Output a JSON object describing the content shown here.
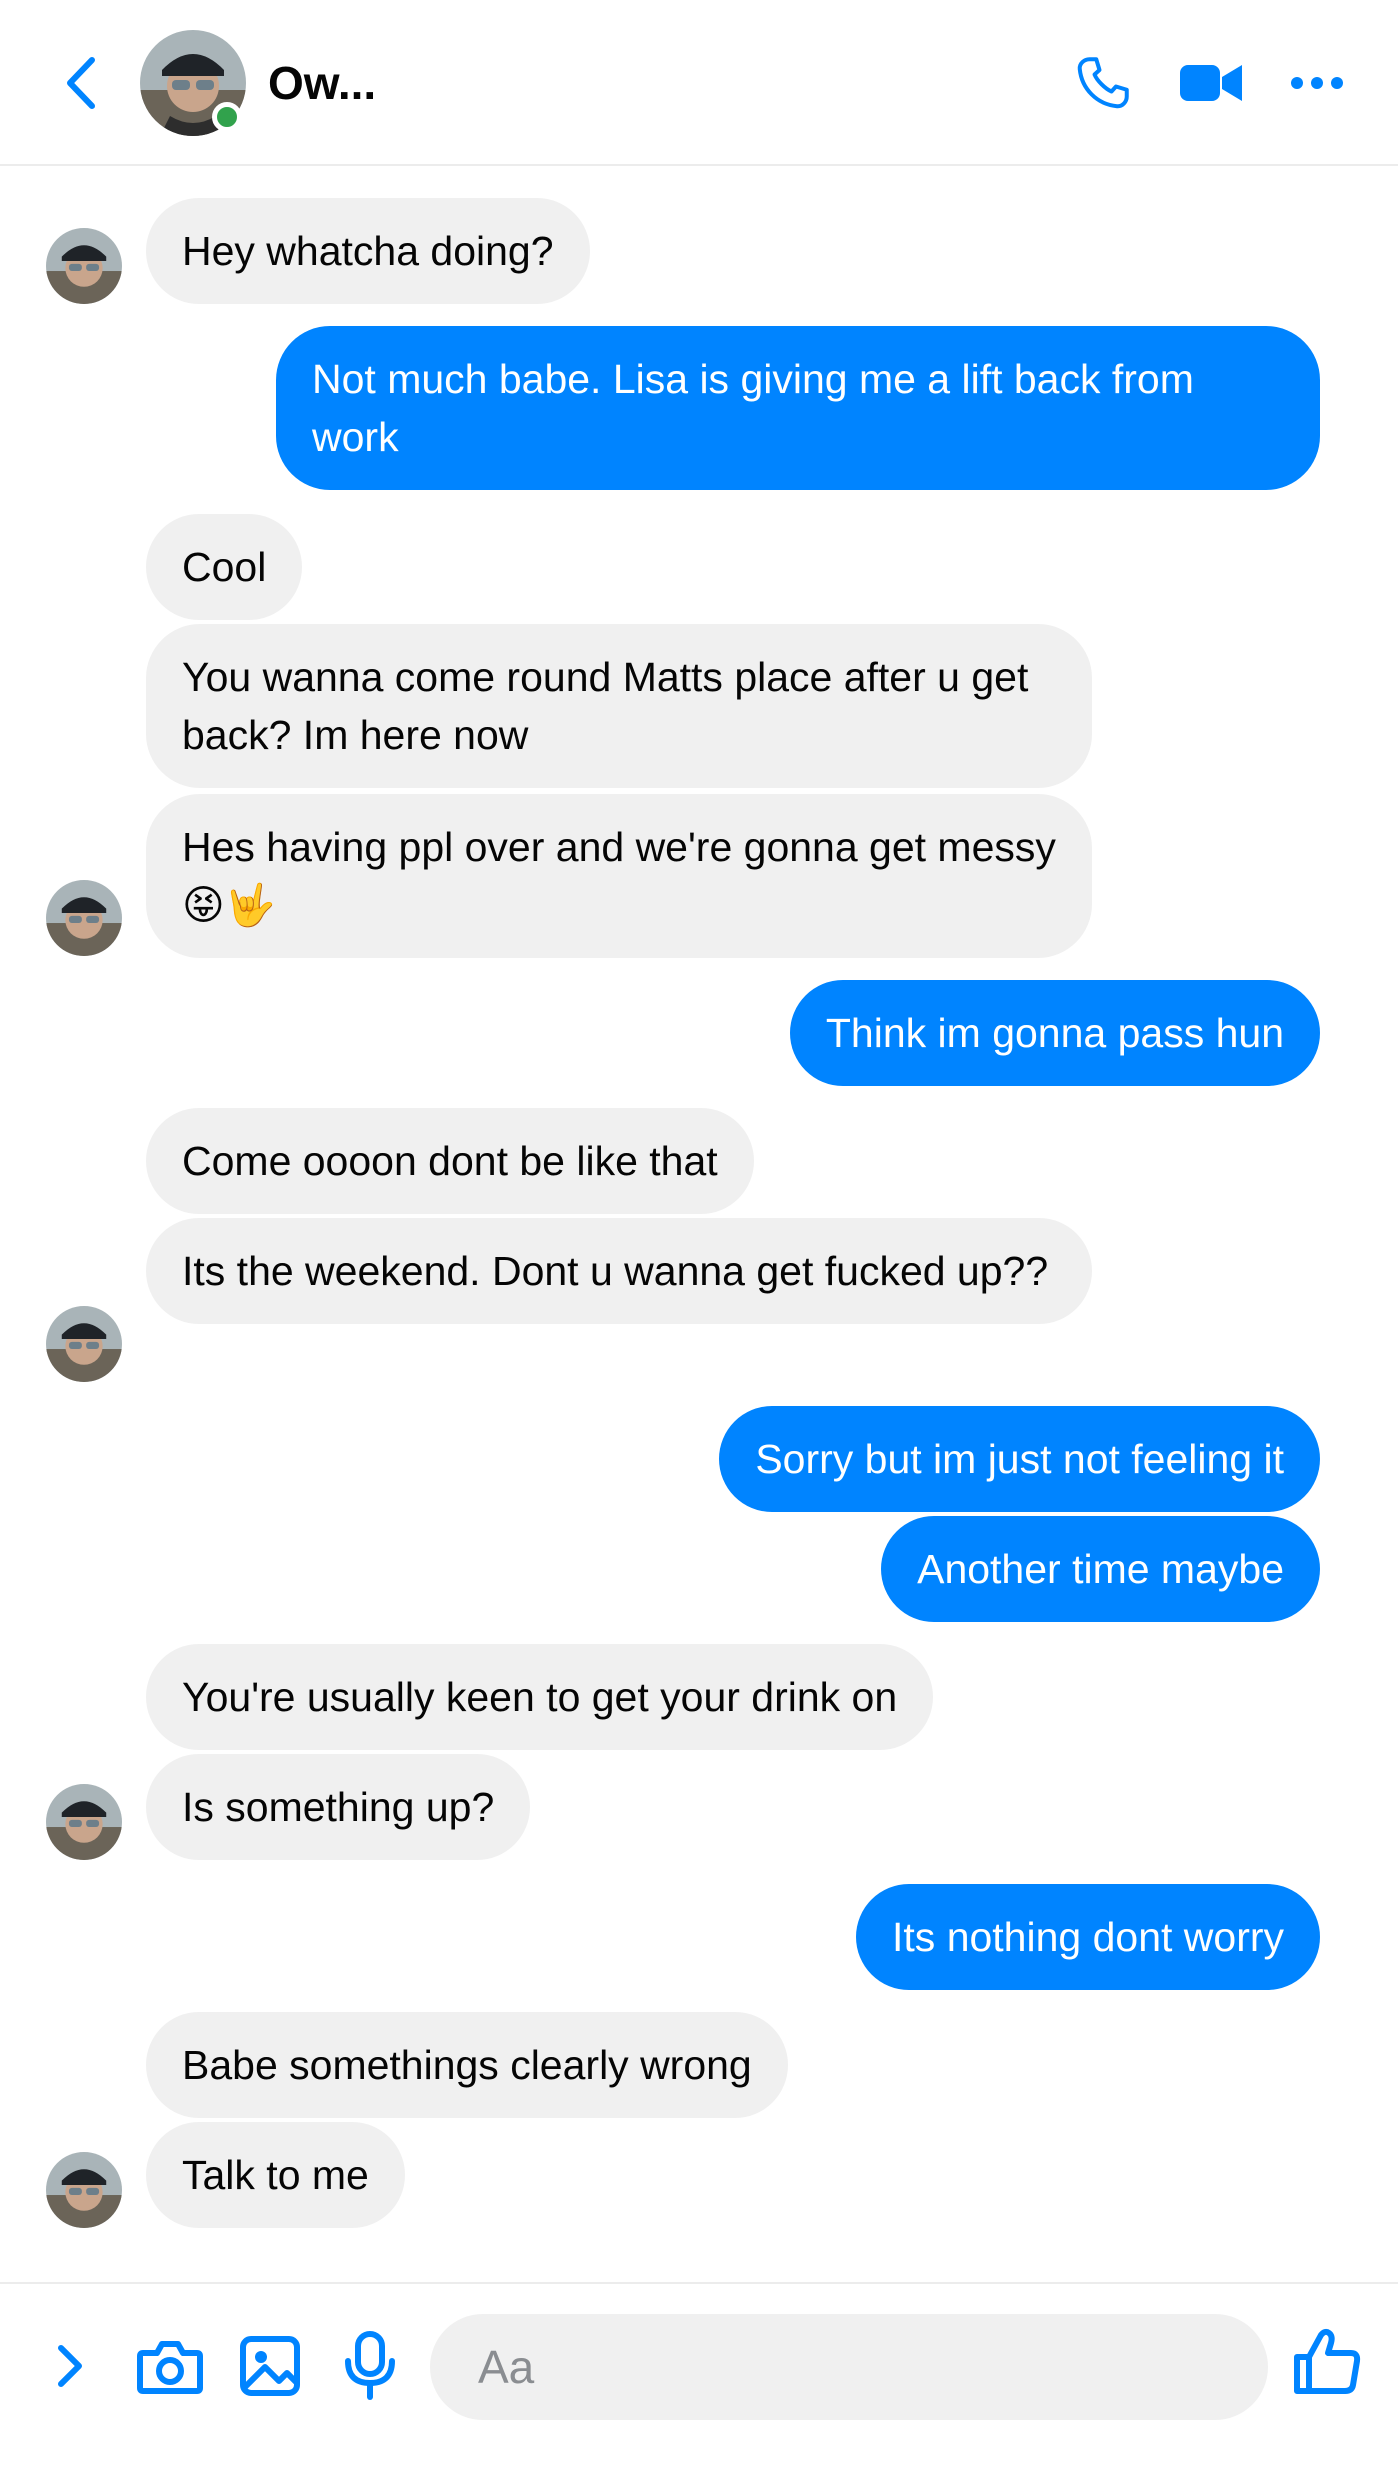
{
  "header": {
    "contact_name": "Ow...",
    "icons": [
      "back-chevron-icon",
      "phone-icon",
      "video-camera-icon",
      "more-dots-icon"
    ]
  },
  "colors": {
    "accent": "#0084ff",
    "incoming_bubble": "#f0f0f0",
    "online": "#31a24c"
  },
  "messages": [
    {
      "from": "them",
      "text": "Hey whatcha doing?"
    },
    {
      "from": "me",
      "text": "Not much babe. Lisa is giving me a lift back from work"
    },
    {
      "from": "them",
      "text": "Cool"
    },
    {
      "from": "them",
      "text": "You wanna come round Matts place after u get back? Im here now"
    },
    {
      "from": "them",
      "text": "Hes having ppl over and we're gonna get messy 😝🤟"
    },
    {
      "from": "me",
      "text": "Think im gonna pass hun"
    },
    {
      "from": "them",
      "text": "Come oooon dont be like that"
    },
    {
      "from": "them",
      "text": "Its the weekend. Dont u wanna get fucked up??"
    },
    {
      "from": "me",
      "text": "Sorry but im just not feeling it"
    },
    {
      "from": "me",
      "text": "Another time maybe"
    },
    {
      "from": "them",
      "text": "You're usually keen to get your drink on"
    },
    {
      "from": "them",
      "text": "Is something up?"
    },
    {
      "from": "me",
      "text": "Its nothing dont worry"
    },
    {
      "from": "them",
      "text": "Babe somethings clearly wrong"
    },
    {
      "from": "them",
      "text": "Talk to me"
    }
  ],
  "composer": {
    "placeholder": "Aa",
    "icons": [
      "expand-chevron-icon",
      "camera-icon",
      "image-icon",
      "microphone-icon",
      "thumbs-up-icon"
    ]
  }
}
